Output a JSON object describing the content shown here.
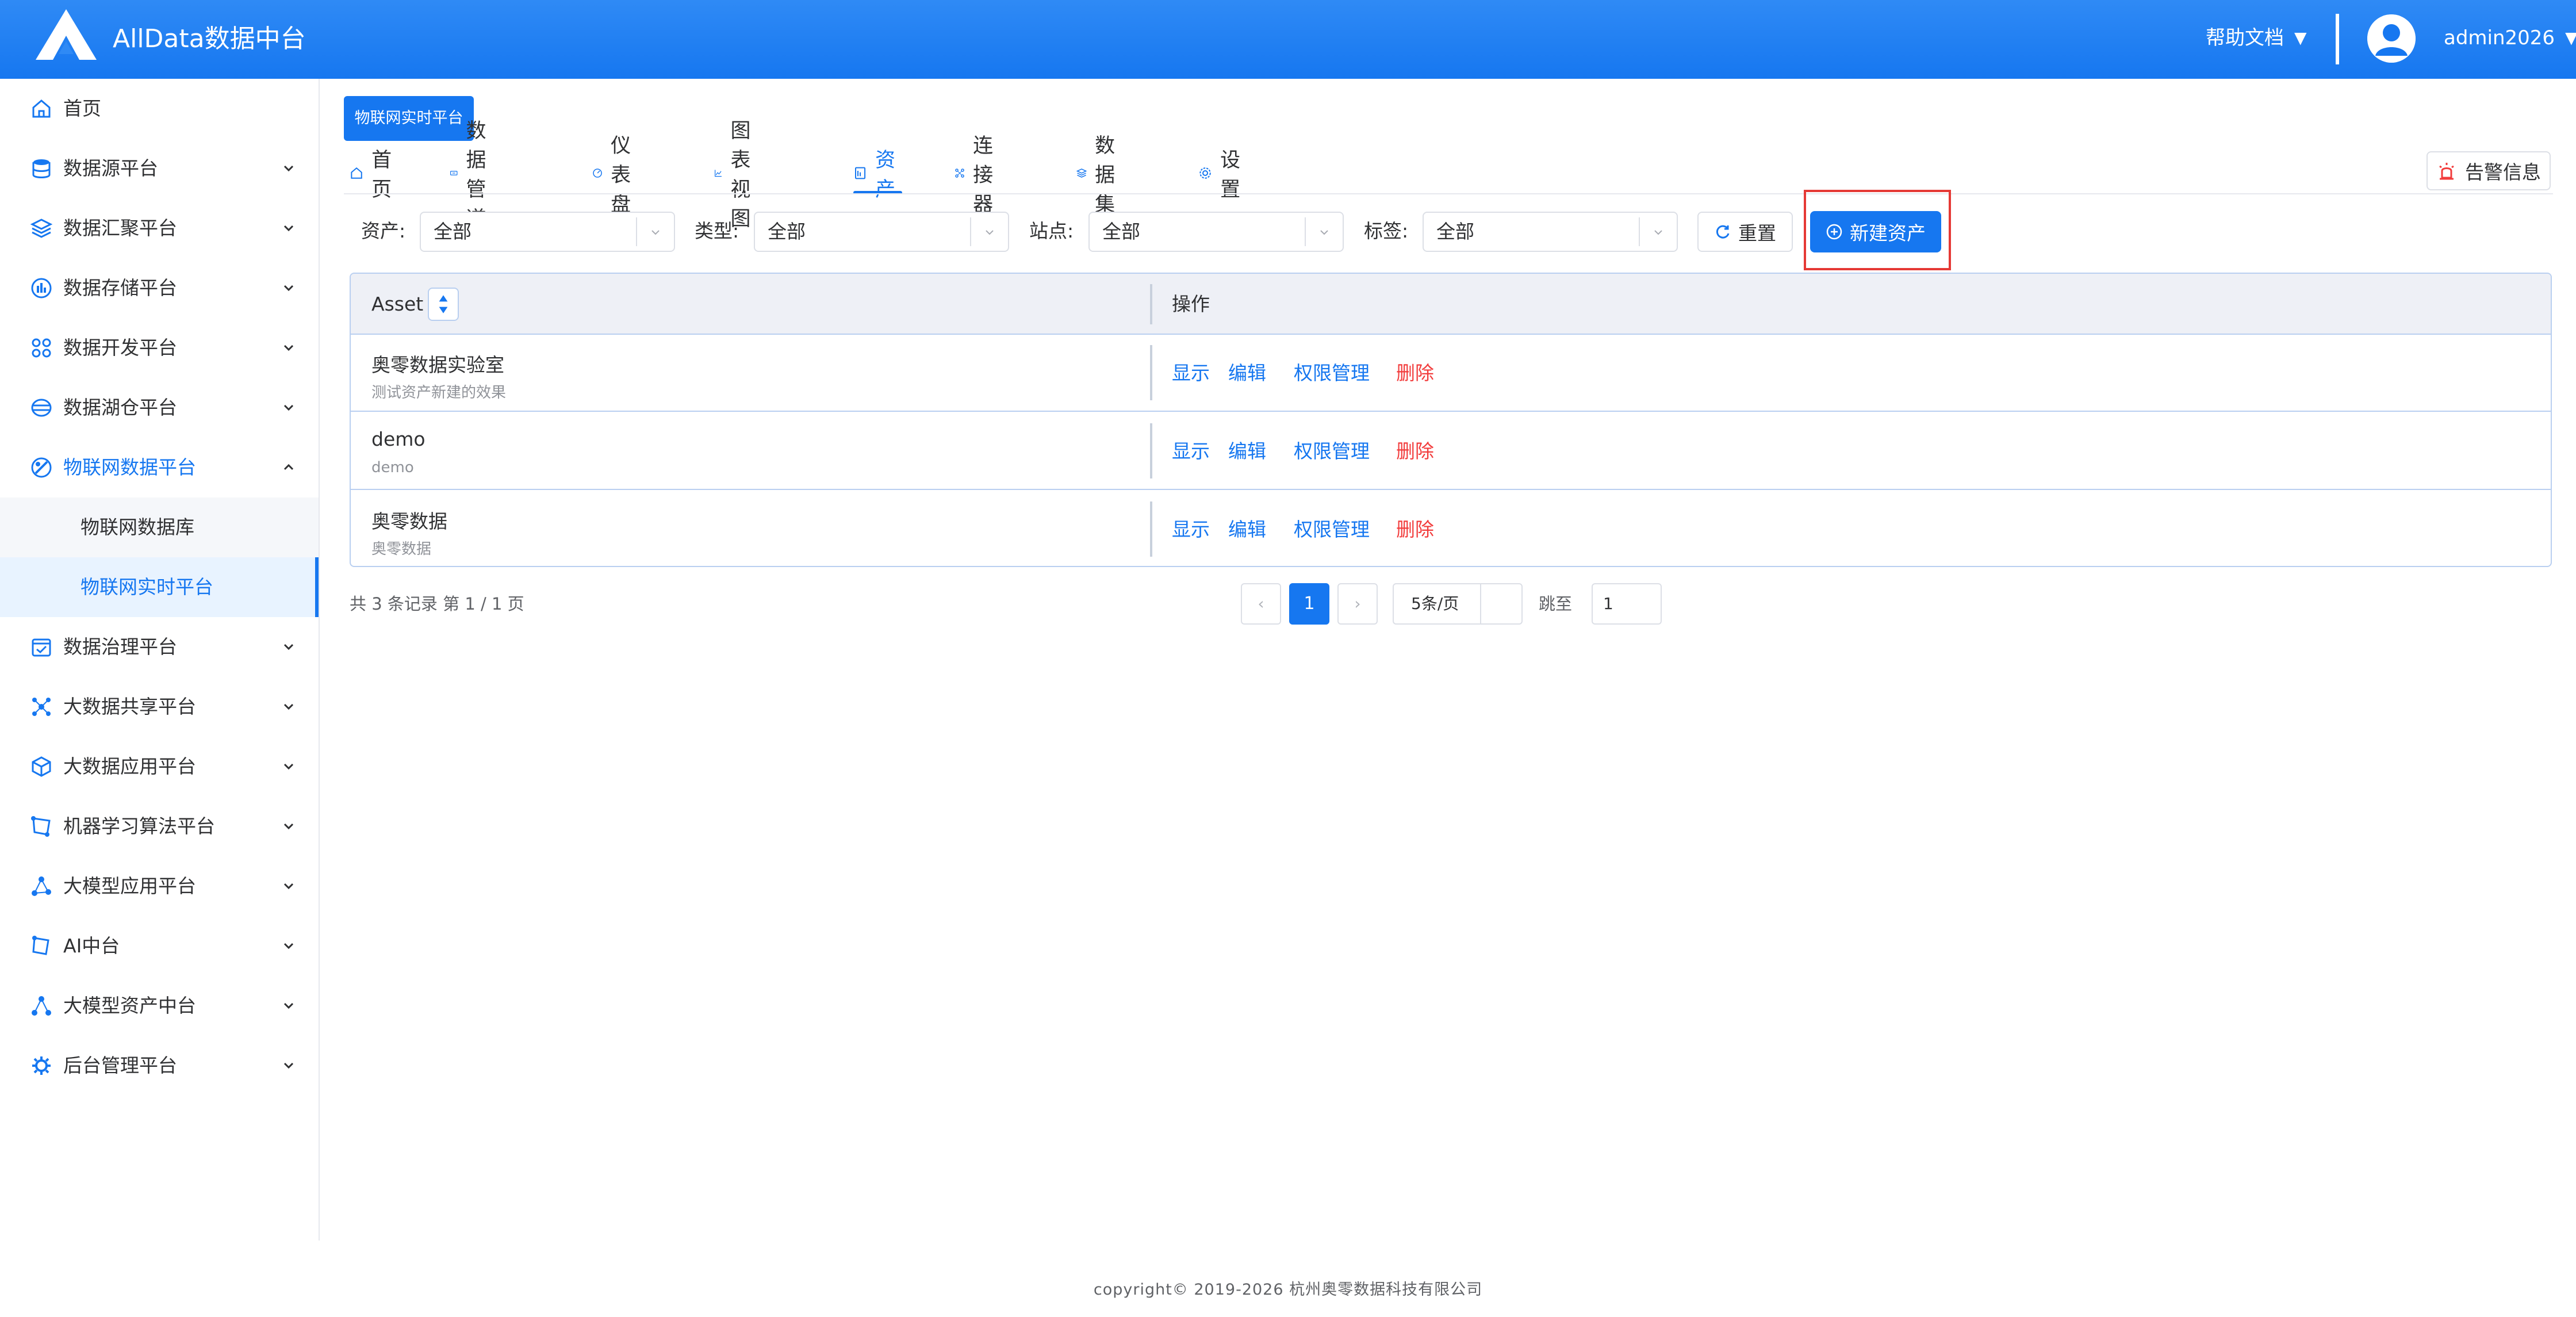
{
  "header": {
    "app_title": "AllData数据中台",
    "help_label": "帮助文档",
    "username": "admin2026"
  },
  "sidebar": {
    "items": [
      {
        "label": "首页",
        "icon": "home-icon"
      },
      {
        "label": "数据源平台",
        "icon": "database-icon"
      },
      {
        "label": "数据汇聚平台",
        "icon": "layers-icon"
      },
      {
        "label": "数据存储平台",
        "icon": "storage-icon"
      },
      {
        "label": "数据开发平台",
        "icon": "grid-icon"
      },
      {
        "label": "数据湖仓平台",
        "icon": "lake-icon"
      },
      {
        "label": "物联网数据平台",
        "icon": "iot-icon"
      },
      {
        "label": "数据治理平台",
        "icon": "governance-icon"
      },
      {
        "label": "大数据共享平台",
        "icon": "share-icon"
      },
      {
        "label": "大数据应用平台",
        "icon": "cube-icon"
      },
      {
        "label": "机器学习算法平台",
        "icon": "ml-icon"
      },
      {
        "label": "大模型应用平台",
        "icon": "model-icon"
      },
      {
        "label": "AI中台",
        "icon": "ai-icon"
      },
      {
        "label": "大模型资产中台",
        "icon": "asset-icon"
      },
      {
        "label": "后台管理平台",
        "icon": "admin-icon"
      }
    ],
    "sub_items": [
      {
        "label": "物联网数据库"
      },
      {
        "label": "物联网实时平台"
      }
    ]
  },
  "main": {
    "tag_chip": "物联网实时平台",
    "tabs": [
      {
        "label": "首页",
        "icon": "home-icon"
      },
      {
        "label": "数据管道",
        "icon": "pipeline-icon"
      },
      {
        "label": "仪表盘",
        "icon": "gauge-icon"
      },
      {
        "label": "图表视图",
        "icon": "chart-icon"
      },
      {
        "label": "资产",
        "icon": "asset-icon"
      },
      {
        "label": "连接器",
        "icon": "connector-icon"
      },
      {
        "label": "数据集",
        "icon": "dataset-icon"
      },
      {
        "label": "设置",
        "icon": "gear-icon"
      }
    ],
    "active_tab": "资产",
    "alert_button": "告警信息",
    "filters": {
      "asset_label": "资产:",
      "asset_value": "全部",
      "type_label": "类型:",
      "type_value": "全部",
      "site_label": "站点:",
      "site_value": "全部",
      "tag_label": "标签:",
      "tag_value": "全部",
      "reset_button": "重置",
      "new_button": "新建资产"
    },
    "table": {
      "col_asset": "Asset",
      "col_actions": "操作",
      "rows": [
        {
          "name": "奥零数据实验室",
          "desc": "测试资产新建的效果"
        },
        {
          "name": "demo",
          "desc": "demo"
        },
        {
          "name": "奥零数据",
          "desc": "奥零数据"
        }
      ],
      "actions": {
        "show": "显示",
        "edit": "编辑",
        "permission": "权限管理",
        "delete": "删除"
      }
    },
    "pagination": {
      "summary": "共 3 条记录 第 1 / 1 页",
      "prev": "‹",
      "current_page": "1",
      "next": "›",
      "page_size": "5条/页",
      "jump_label": "跳至",
      "jump_value": "1"
    }
  },
  "footer": {
    "copyright": "copyright© 2019-2026 杭州奥零数据科技有限公司"
  },
  "colors": {
    "brand": "#1677f0",
    "danger": "#f23c3c",
    "highlight": "#e53935"
  }
}
